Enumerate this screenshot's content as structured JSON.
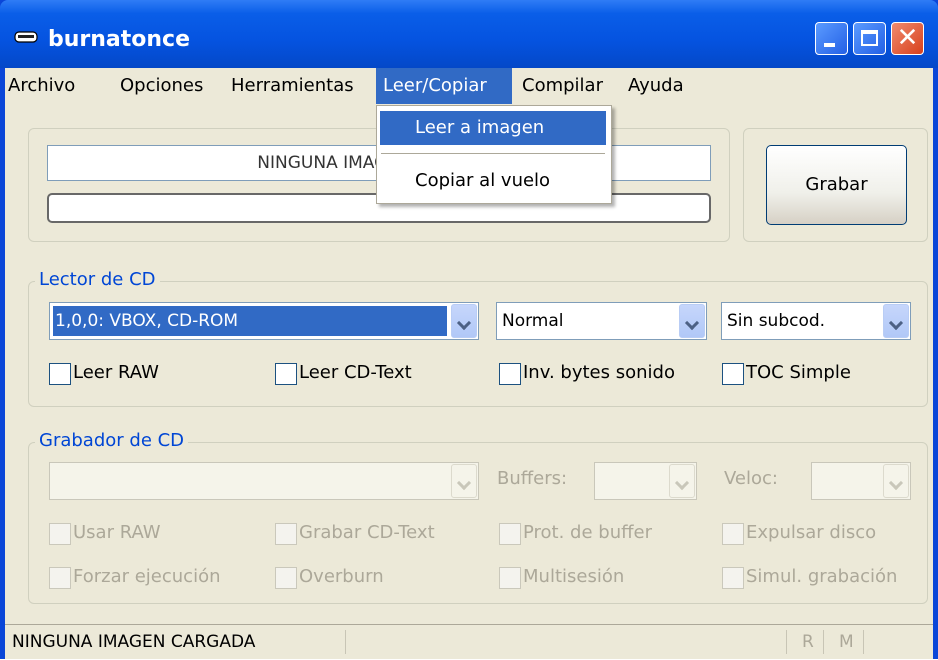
{
  "window": {
    "title": "burnatonce"
  },
  "menu": [
    {
      "label": "Archivo"
    },
    {
      "label": "Opciones"
    },
    {
      "label": "Herramientas"
    },
    {
      "label": "Leer/Copiar"
    },
    {
      "label": "Compilar"
    },
    {
      "label": "Ayuda"
    }
  ],
  "popup": {
    "items": [
      {
        "label": "Leer a imagen"
      },
      {
        "label": "Copiar al vuelo"
      }
    ]
  },
  "image": {
    "name_field": "NINGUNA IMAGEN CARGADA",
    "progress": 0
  },
  "record_button": "Grabar",
  "reader": {
    "legend": "Lector de CD",
    "drive": "1,0,0: VBOX, CD-ROM",
    "mode": "Normal",
    "subcode": "Sin subcod.",
    "options": [
      {
        "label": "Leer RAW",
        "checked": false
      },
      {
        "label": "Leer CD-Text",
        "checked": false
      },
      {
        "label": "Inv. bytes sonido",
        "checked": false
      },
      {
        "label": "TOC Simple",
        "checked": false
      }
    ]
  },
  "writer": {
    "legend": "Grabador de CD",
    "drive": "",
    "buffers_label": "Buffers:",
    "speed_label": "Veloc:",
    "options": [
      {
        "label": "Usar RAW",
        "checked": false
      },
      {
        "label": "Grabar CD-Text",
        "checked": false
      },
      {
        "label": "Prot. de buffer",
        "checked": false
      },
      {
        "label": "Expulsar disco",
        "checked": false
      },
      {
        "label": "Forzar ejecución",
        "checked": false
      },
      {
        "label": "Overburn",
        "checked": false
      },
      {
        "label": "Multisesión",
        "checked": false
      },
      {
        "label": "Simul. grabación",
        "checked": false
      }
    ]
  },
  "status": {
    "text": "NINGUNA IMAGEN CARGADA",
    "r": "R",
    "m": "M"
  },
  "colors": {
    "title_blue": "#0553e0",
    "menu_highlight": "#316ac5",
    "face": "#ece9d8",
    "legend": "#0046d5"
  }
}
